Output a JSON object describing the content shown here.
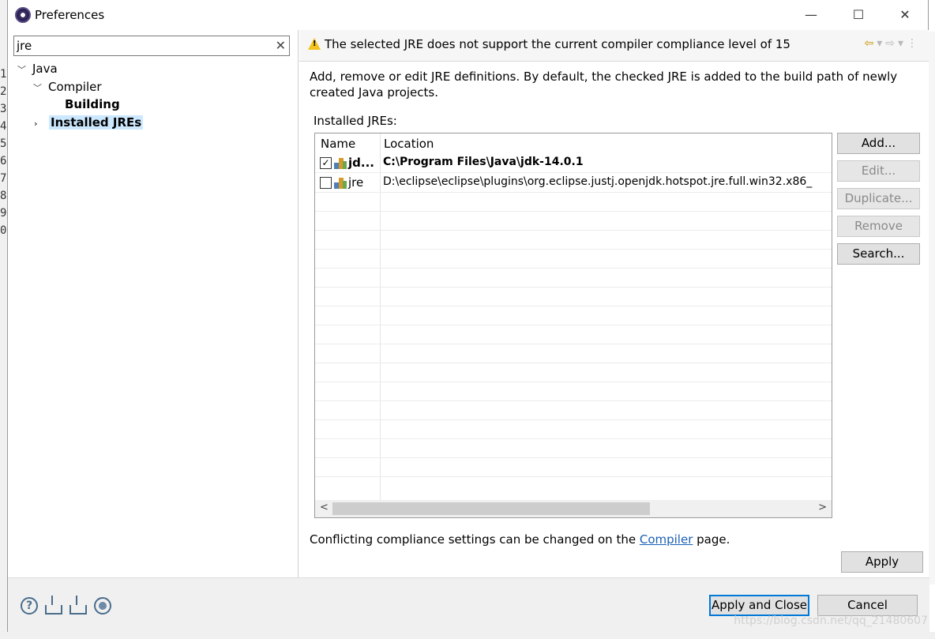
{
  "window": {
    "title": "Preferences",
    "minimize": "—",
    "maximize": "☐",
    "close": "✕"
  },
  "filter": {
    "value": "jre",
    "clear_icon": "✕"
  },
  "tree": [
    {
      "label": "Java",
      "arrow": "﹀"
    },
    {
      "label": "Compiler",
      "arrow": "﹀"
    },
    {
      "label": "Building"
    },
    {
      "label": "Installed JREs",
      "arrow": "›"
    }
  ],
  "header": {
    "message": "The selected JRE does not support the current compiler compliance level of 15",
    "warning_icon": "warning-icon"
  },
  "page": {
    "description": "Add, remove or edit JRE definitions. By default, the checked JRE is added to the build path of newly created Java projects.",
    "installed_label": "Installed JREs:",
    "conflict_prefix": "Conflicting compliance settings can be changed on the ",
    "conflict_link": "Compiler",
    "conflict_suffix": " page."
  },
  "table": {
    "columns": [
      "Name",
      "Location"
    ],
    "rows": [
      {
        "checked": true,
        "name": "jd...",
        "location": "C:\\Program Files\\Java\\jdk-14.0.1",
        "bold": true
      },
      {
        "checked": false,
        "name": "jre",
        "location": "D:\\eclipse\\eclipse\\plugins\\org.eclipse.justj.openjdk.hotspot.jre.full.win32.x86_",
        "bold": false
      }
    ]
  },
  "side_buttons": {
    "add": "Add...",
    "edit": "Edit...",
    "duplicate": "Duplicate...",
    "remove": "Remove",
    "search": "Search..."
  },
  "buttons": {
    "apply": "Apply",
    "apply_close": "Apply and Close",
    "cancel": "Cancel"
  },
  "watermark": "https://blog.csdn.net/qq_21480607",
  "colors": {
    "selection": "#cce8ff",
    "link": "#1a5fb4",
    "warning": "#f3c31d",
    "default_button_border": "#0078d7"
  }
}
